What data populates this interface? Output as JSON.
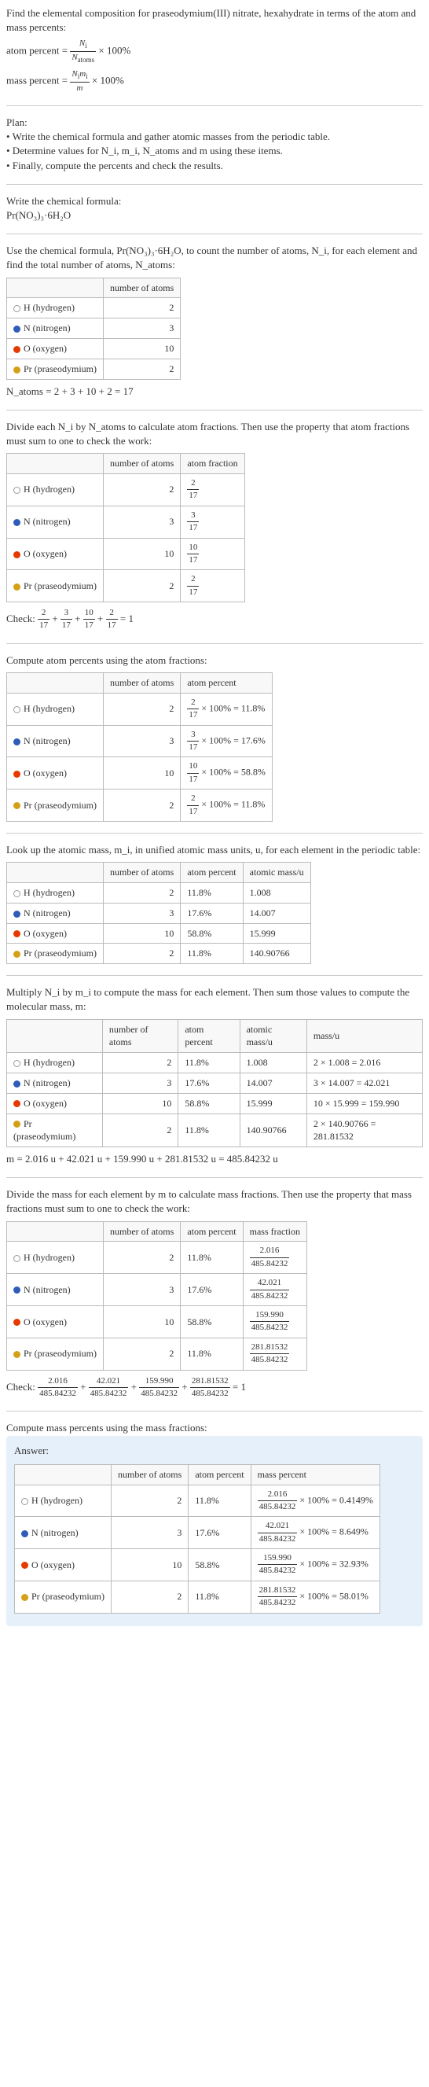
{
  "intro": {
    "title_line1": "Find the elemental composition for praseodymium(III) nitrate, hexahydrate in terms of the atom and mass percents:",
    "atom_percent_label": "atom percent =",
    "mass_percent_label": "mass percent =",
    "times100": " × 100%"
  },
  "plan": {
    "heading": "Plan:",
    "b1": "• Write the chemical formula and gather atomic masses from the periodic table.",
    "b2": "• Determine values for N_i, m_i, N_atoms and m using these items.",
    "b3": "• Finally, compute the percents and check the results."
  },
  "chem_formula": {
    "heading": "Write the chemical formula:",
    "formula": "Pr(NO₃)₃·6H₂O"
  },
  "count_atoms": {
    "heading": "Use the chemical formula, Pr(NO₃)₃·6H₂O, to count the number of atoms, N_i, for each element and find the total number of atoms, N_atoms:",
    "col_num": "number of atoms",
    "rows": [
      {
        "el": "H (hydrogen)",
        "n": "2"
      },
      {
        "el": "N (nitrogen)",
        "n": "3"
      },
      {
        "el": "O (oxygen)",
        "n": "10"
      },
      {
        "el": "Pr (praseodymium)",
        "n": "2"
      }
    ],
    "total": "N_atoms = 2 + 3 + 10 + 2 = 17"
  },
  "atom_fractions": {
    "heading": "Divide each N_i by N_atoms to calculate atom fractions. Then use the property that atom fractions must sum to one to check the work:",
    "col_num": "number of atoms",
    "col_frac": "atom fraction",
    "rows": [
      {
        "el": "H (hydrogen)",
        "n": "2",
        "num": "2",
        "den": "17"
      },
      {
        "el": "N (nitrogen)",
        "n": "3",
        "num": "3",
        "den": "17"
      },
      {
        "el": "O (oxygen)",
        "n": "10",
        "num": "10",
        "den": "17"
      },
      {
        "el": "Pr (praseodymium)",
        "n": "2",
        "num": "2",
        "den": "17"
      }
    ],
    "check_label": "Check: ",
    "check_eq": " = 1"
  },
  "atom_percents": {
    "heading": "Compute atom percents using the atom fractions:",
    "col_num": "number of atoms",
    "col_ap": "atom percent",
    "rows": [
      {
        "el": "H (hydrogen)",
        "n": "2",
        "num": "2",
        "den": "17",
        "pct": " × 100% = 11.8%"
      },
      {
        "el": "N (nitrogen)",
        "n": "3",
        "num": "3",
        "den": "17",
        "pct": " × 100% = 17.6%"
      },
      {
        "el": "O (oxygen)",
        "n": "10",
        "num": "10",
        "den": "17",
        "pct": " × 100% = 58.8%"
      },
      {
        "el": "Pr (praseodymium)",
        "n": "2",
        "num": "2",
        "den": "17",
        "pct": " × 100% = 11.8%"
      }
    ]
  },
  "atomic_mass": {
    "heading": "Look up the atomic mass, m_i, in unified atomic mass units, u, for each element in the periodic table:",
    "col_num": "number of atoms",
    "col_ap": "atom percent",
    "col_mass": "atomic mass/u",
    "rows": [
      {
        "el": "H (hydrogen)",
        "n": "2",
        "ap": "11.8%",
        "m": "1.008"
      },
      {
        "el": "N (nitrogen)",
        "n": "3",
        "ap": "17.6%",
        "m": "14.007"
      },
      {
        "el": "O (oxygen)",
        "n": "10",
        "ap": "58.8%",
        "m": "15.999"
      },
      {
        "el": "Pr (praseodymium)",
        "n": "2",
        "ap": "11.8%",
        "m": "140.90766"
      }
    ]
  },
  "molecular_mass": {
    "heading": "Multiply N_i by m_i to compute the mass for each element. Then sum those values to compute the molecular mass, m:",
    "col_num": "number of atoms",
    "col_ap": "atom percent",
    "col_amass": "atomic mass/u",
    "col_mass": "mass/u",
    "rows": [
      {
        "el": "H (hydrogen)",
        "n": "2",
        "ap": "11.8%",
        "am": "1.008",
        "mass": "2 × 1.008 = 2.016"
      },
      {
        "el": "N (nitrogen)",
        "n": "3",
        "ap": "17.6%",
        "am": "14.007",
        "mass": "3 × 14.007 = 42.021"
      },
      {
        "el": "O (oxygen)",
        "n": "10",
        "ap": "58.8%",
        "am": "15.999",
        "mass": "10 × 15.999 = 159.990"
      },
      {
        "el": "Pr (praseodymium)",
        "n": "2",
        "ap": "11.8%",
        "am": "140.90766",
        "mass": "2 × 140.90766 = 281.81532"
      }
    ],
    "total": "m = 2.016 u + 42.021 u + 159.990 u + 281.81532 u = 485.84232 u"
  },
  "mass_fractions": {
    "heading": "Divide the mass for each element by m to calculate mass fractions. Then use the property that mass fractions must sum to one to check the work:",
    "col_num": "number of atoms",
    "col_ap": "atom percent",
    "col_mf": "mass fraction",
    "rows": [
      {
        "el": "H (hydrogen)",
        "n": "2",
        "ap": "11.8%",
        "num": "2.016",
        "den": "485.84232"
      },
      {
        "el": "N (nitrogen)",
        "n": "3",
        "ap": "17.6%",
        "num": "42.021",
        "den": "485.84232"
      },
      {
        "el": "O (oxygen)",
        "n": "10",
        "ap": "58.8%",
        "num": "159.990",
        "den": "485.84232"
      },
      {
        "el": "Pr (praseodymium)",
        "n": "2",
        "ap": "11.8%",
        "num": "281.81532",
        "den": "485.84232"
      }
    ],
    "check_label": "Check: ",
    "check_eq": " = 1"
  },
  "mass_percents": {
    "heading": "Compute mass percents using the mass fractions:",
    "answer_label": "Answer:",
    "col_num": "number of atoms",
    "col_ap": "atom percent",
    "col_mp": "mass percent",
    "rows": [
      {
        "el": "H (hydrogen)",
        "n": "2",
        "ap": "11.8%",
        "num": "2.016",
        "den": "485.84232",
        "pct": "100% = 0.4149%"
      },
      {
        "el": "N (nitrogen)",
        "n": "3",
        "ap": "17.6%",
        "num": "42.021",
        "den": "485.84232",
        "pct": "100% = 8.649%"
      },
      {
        "el": "O (oxygen)",
        "n": "10",
        "ap": "58.8%",
        "num": "159.990",
        "den": "485.84232",
        "pct": "100% = 32.93%"
      },
      {
        "el": "Pr (praseodymium)",
        "n": "2",
        "ap": "11.8%",
        "num": "281.81532",
        "den": "485.84232",
        "pct": "100% = 58.01%"
      }
    ]
  }
}
